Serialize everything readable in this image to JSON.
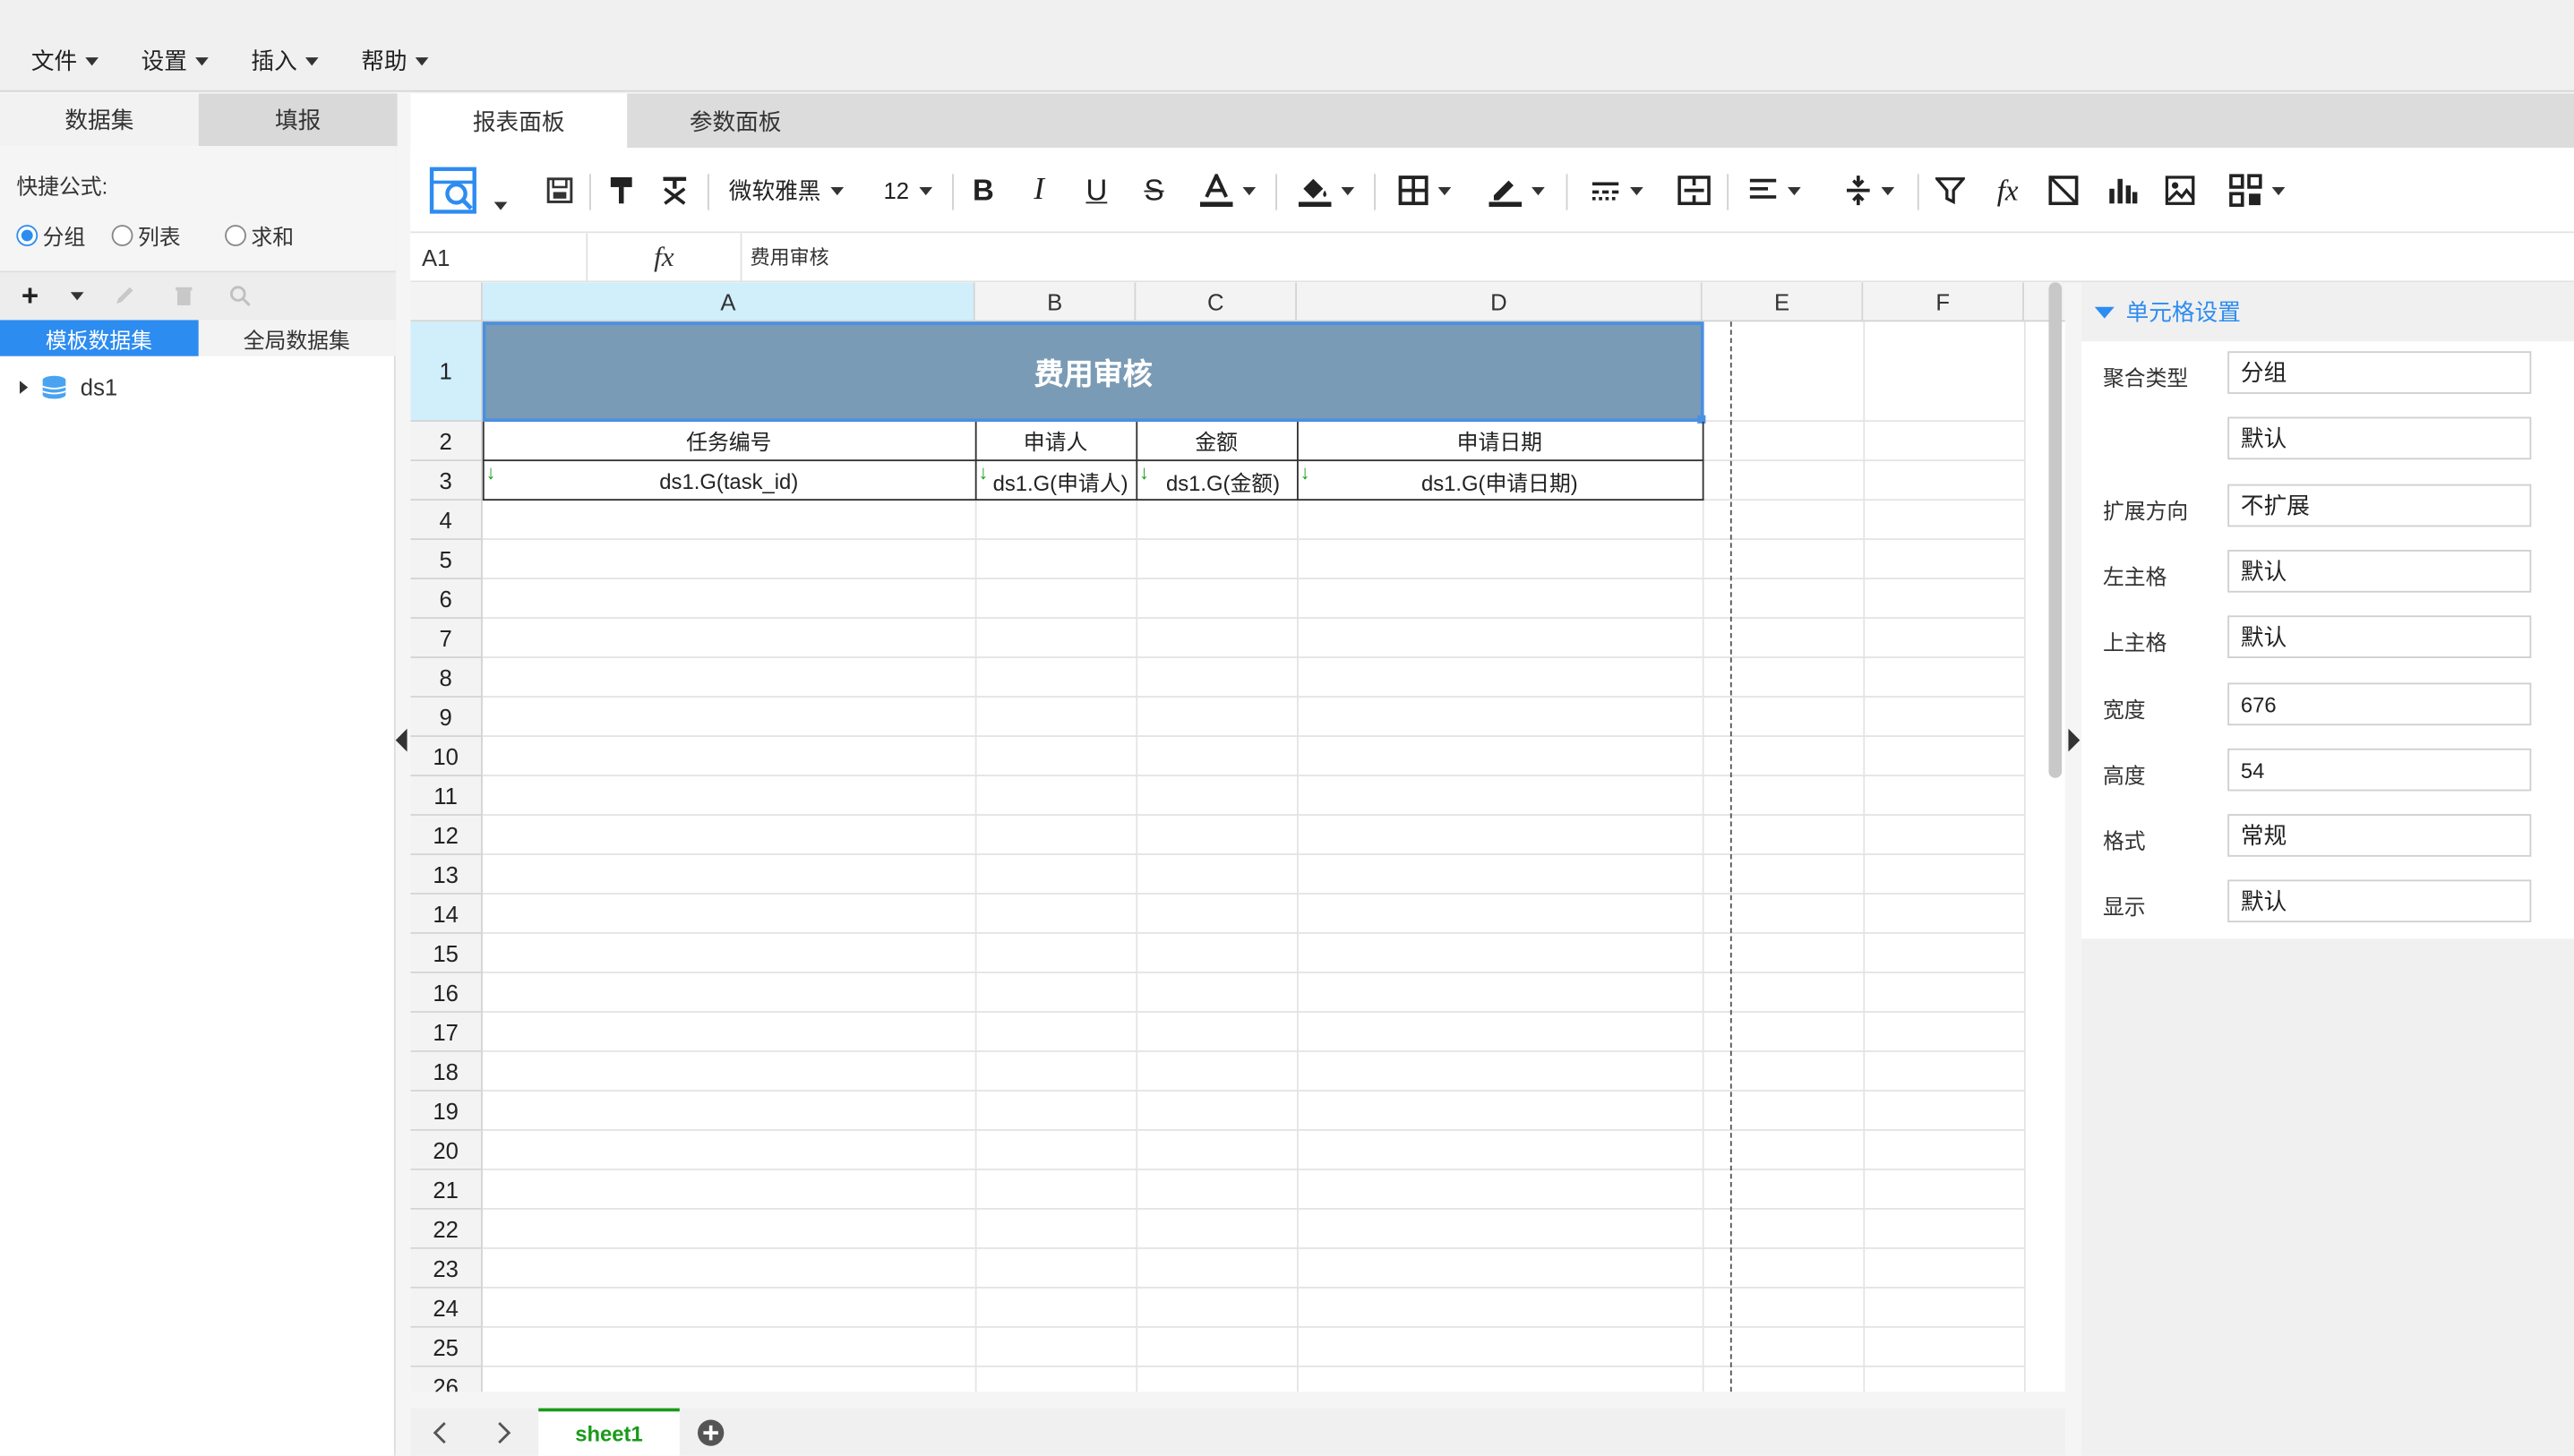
{
  "menu": [
    {
      "label": "文件"
    },
    {
      "label": "设置"
    },
    {
      "label": "插入"
    },
    {
      "label": "帮助"
    }
  ],
  "left_panel": {
    "tabs": [
      "数据集",
      "填报"
    ],
    "quick_formula_label": "快捷公式:",
    "radios": [
      {
        "label": "分组",
        "checked": true
      },
      {
        "label": "列表",
        "checked": false
      },
      {
        "label": "求和",
        "checked": false
      }
    ],
    "dataset_tabs": [
      "模板数据集",
      "全局数据集"
    ],
    "tree": [
      {
        "label": "ds1"
      }
    ]
  },
  "panel_tabs": [
    "报表面板",
    "参数面板"
  ],
  "toolbar": {
    "font_name": "微软雅黑",
    "font_size": "12",
    "icons": [
      "preview-icon",
      "save-icon",
      "format-painter-icon",
      "clear-format-icon",
      "bold-icon",
      "italic-icon",
      "underline-icon",
      "strikethrough-icon",
      "font-color-icon",
      "fill-color-icon",
      "border-icon",
      "border-color-icon",
      "border-style-icon",
      "merge-cells-icon",
      "align-icon",
      "vertical-align-icon",
      "filter-icon",
      "function-icon",
      "slash-cell-icon",
      "chart-icon",
      "image-icon",
      "more-icon"
    ]
  },
  "formula_bar": {
    "cell_ref": "A1",
    "fx": "fx",
    "value": "费用审核"
  },
  "sheet": {
    "columns": [
      "A",
      "B",
      "C",
      "D",
      "E",
      "F"
    ],
    "rows": [
      "1",
      "2",
      "3",
      "4",
      "5",
      "6",
      "7",
      "8",
      "9",
      "10",
      "11",
      "12",
      "13",
      "14",
      "15",
      "16",
      "17",
      "18",
      "19",
      "20",
      "21",
      "22",
      "23",
      "24",
      "25",
      "26"
    ],
    "title": "费用审核",
    "headers": [
      "任务编号",
      "申请人",
      "金额",
      "申请日期"
    ],
    "data_cells": [
      "ds1.G(task_id)",
      "ds1.G(申请人)",
      "ds1.G(金额)",
      "ds1.G(申请日期)"
    ],
    "expand_arrow": "↓",
    "title_fill": "#7a9bb5",
    "header_fill": "#cdeefa"
  },
  "sheet_tabs": {
    "active": "sheet1"
  },
  "cell_settings": {
    "title": "单元格设置",
    "rows": [
      {
        "label": "聚合类型",
        "value": "分组"
      },
      {
        "label": "",
        "value": "默认"
      },
      {
        "label": "扩展方向",
        "value": "不扩展"
      },
      {
        "label": "左主格",
        "value": "默认"
      },
      {
        "label": "上主格",
        "value": "默认"
      },
      {
        "label": "宽度",
        "value": "676"
      },
      {
        "label": "高度",
        "value": "54"
      },
      {
        "label": "格式",
        "value": "常规"
      },
      {
        "label": "显示",
        "value": "默认"
      }
    ]
  },
  "colors": {
    "accent": "#2d8cf0",
    "dataset_tab_active": "#2d8cf0",
    "sheet_tab_text": "#1a9a1a",
    "selection_border": "#4a90e2"
  }
}
